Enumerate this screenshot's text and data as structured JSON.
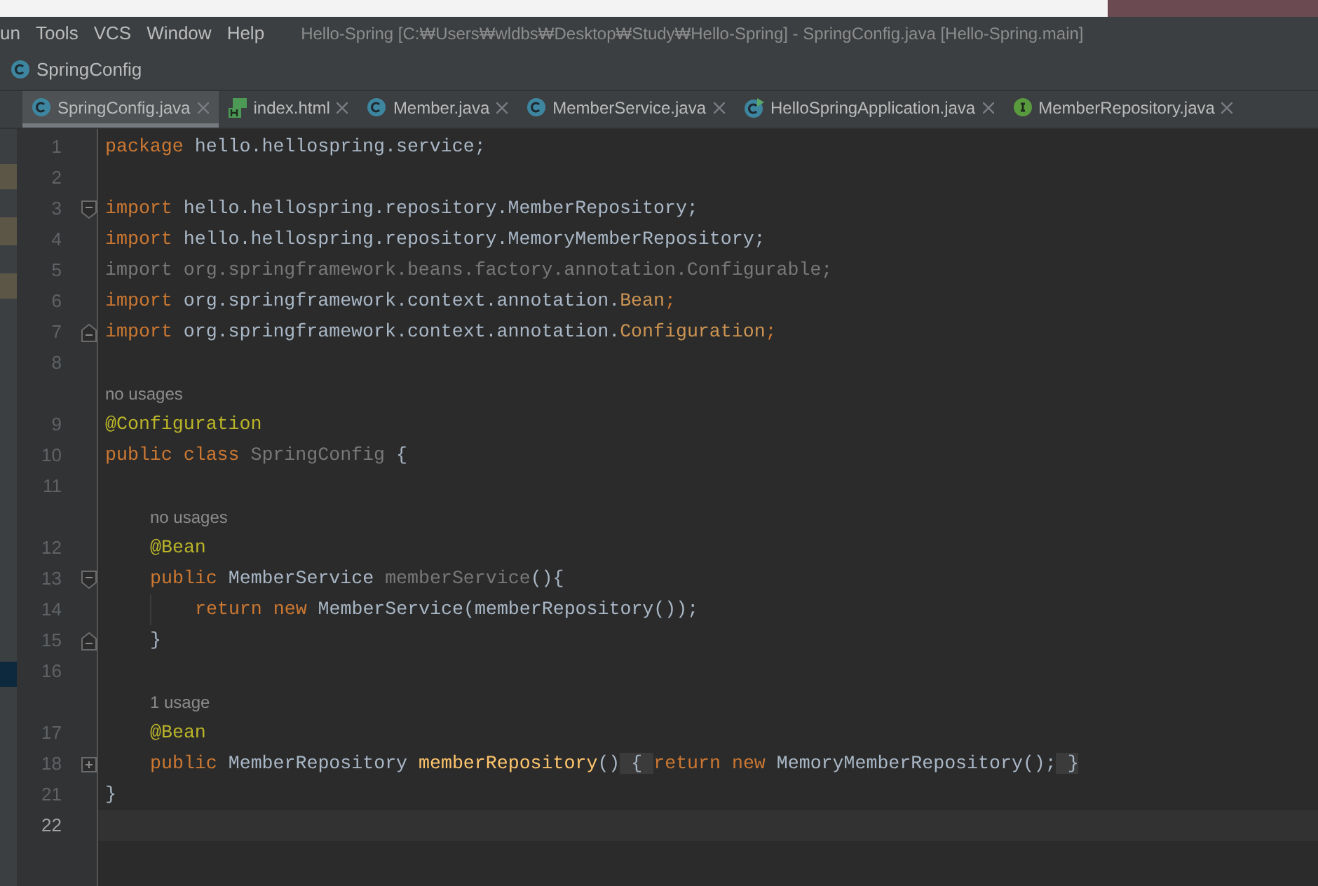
{
  "menu": [
    {
      "label": "un"
    },
    {
      "label": "Tools"
    },
    {
      "label": "VCS"
    },
    {
      "label": "Window"
    },
    {
      "label": "Help"
    }
  ],
  "window": {
    "title": "Hello-Spring [C:₩Users₩wldbs₩Desktop₩Study₩Hello-Spring] - SpringConfig.java [Hello-Spring.main]"
  },
  "breadcrumb": {
    "label": "SpringConfig"
  },
  "tabs": [
    {
      "label": "SpringConfig.java",
      "kind": "class",
      "selected": true
    },
    {
      "label": "index.html",
      "kind": "html",
      "selected": false
    },
    {
      "label": "Member.java",
      "kind": "class",
      "selected": false
    },
    {
      "label": "MemberService.java",
      "kind": "class",
      "selected": false
    },
    {
      "label": "HelloSpringApplication.java",
      "kind": "app",
      "selected": false
    },
    {
      "label": "MemberRepository.java",
      "kind": "interface",
      "selected": false
    }
  ],
  "editor": {
    "lines": [
      {
        "kind": "code",
        "number": "1",
        "tokens": [
          {
            "text": "package ",
            "kind": "keyword"
          },
          {
            "text": "hello.hellospring.service;",
            "kind": "plain"
          }
        ]
      },
      {
        "kind": "code",
        "number": "2"
      },
      {
        "kind": "code",
        "number": "3",
        "fold_start": true,
        "tokens": [
          {
            "text": "import ",
            "kind": "keyword"
          },
          {
            "text": "hello.hellospring.repository.MemberRepository;",
            "kind": "plain"
          }
        ]
      },
      {
        "kind": "code",
        "number": "4",
        "tokens": [
          {
            "text": "import ",
            "kind": "keyword"
          },
          {
            "text": "hello.hellospring.repository.MemoryMemberRepository;",
            "kind": "plain"
          }
        ]
      },
      {
        "kind": "code",
        "number": "5",
        "tokens": [
          {
            "text": "import org.springframework.beans.factory.annotation.Configurable;",
            "kind": "unused"
          }
        ]
      },
      {
        "kind": "code",
        "number": "6",
        "tokens": [
          {
            "text": "import ",
            "kind": "keyword"
          },
          {
            "text": "org.springframework.context.annotation.",
            "kind": "plain"
          },
          {
            "text": "Bean",
            "kind": "type-ref"
          },
          {
            "text": ";",
            "kind": "keyword"
          }
        ]
      },
      {
        "kind": "code",
        "number": "7",
        "fold_end": true,
        "tokens": [
          {
            "text": "import ",
            "kind": "keyword"
          },
          {
            "text": "org.springframework.context.annotation.",
            "kind": "plain"
          },
          {
            "text": "Configuration",
            "kind": "type-ref"
          },
          {
            "text": ";",
            "kind": "keyword"
          }
        ]
      },
      {
        "kind": "code",
        "number": "8"
      },
      {
        "kind": "hint",
        "text": "no usages"
      },
      {
        "kind": "code",
        "number": "9",
        "tokens": [
          {
            "text": "@Configuration",
            "kind": "annotation"
          }
        ]
      },
      {
        "kind": "code",
        "number": "10",
        "tokens": [
          {
            "text": "public class ",
            "kind": "keyword"
          },
          {
            "text": "SpringConfig",
            "kind": "unused"
          },
          {
            "text": " {",
            "kind": "plain"
          }
        ],
        "children": [
          {
            "kind": "code",
            "number": "11"
          },
          {
            "kind": "hint",
            "text": "no usages"
          },
          {
            "kind": "code",
            "number": "12",
            "tokens": [
              {
                "text": "@Bean",
                "kind": "annotation"
              }
            ]
          },
          {
            "kind": "code",
            "number": "13",
            "fold_start": true,
            "tokens": [
              {
                "text": "public ",
                "kind": "keyword"
              },
              {
                "text": "MemberService ",
                "kind": "plain"
              },
              {
                "text": "memberService",
                "kind": "unused"
              },
              {
                "text": "(){",
                "kind": "plain"
              }
            ],
            "children": [
              {
                "kind": "code",
                "number": "14",
                "tokens": [
                  {
                    "text": "return new ",
                    "kind": "keyword"
                  },
                  {
                    "text": "MemberService(memberRepository());",
                    "kind": "plain"
                  }
                ]
              }
            ]
          },
          {
            "kind": "code",
            "number": "15",
            "fold_end": true,
            "tokens": [
              {
                "text": "}",
                "kind": "plain"
              }
            ]
          },
          {
            "kind": "code",
            "number": "16"
          },
          {
            "kind": "hint",
            "text": "1 usage"
          },
          {
            "kind": "code",
            "number": "17",
            "tokens": [
              {
                "text": "@Bean",
                "kind": "annotation"
              }
            ]
          },
          {
            "kind": "code",
            "number": "18",
            "folded": true,
            "tokens": [
              {
                "text": "public ",
                "kind": "keyword"
              },
              {
                "text": "MemberRepository ",
                "kind": "plain"
              },
              {
                "text": "memberRepository",
                "kind": "method"
              },
              {
                "text": "()",
                "kind": "plain"
              },
              {
                "text": " { ",
                "kind": "folded"
              },
              {
                "text": "return new ",
                "kind": "keyword"
              },
              {
                "text": "MemoryMemberRepository();",
                "kind": "plain"
              },
              {
                "text": " }",
                "kind": "folded"
              }
            ]
          }
        ]
      },
      {
        "kind": "code",
        "number": "21",
        "tokens": [
          {
            "text": "}",
            "kind": "plain"
          }
        ]
      },
      {
        "kind": "code",
        "number": "22",
        "current": true
      }
    ]
  }
}
